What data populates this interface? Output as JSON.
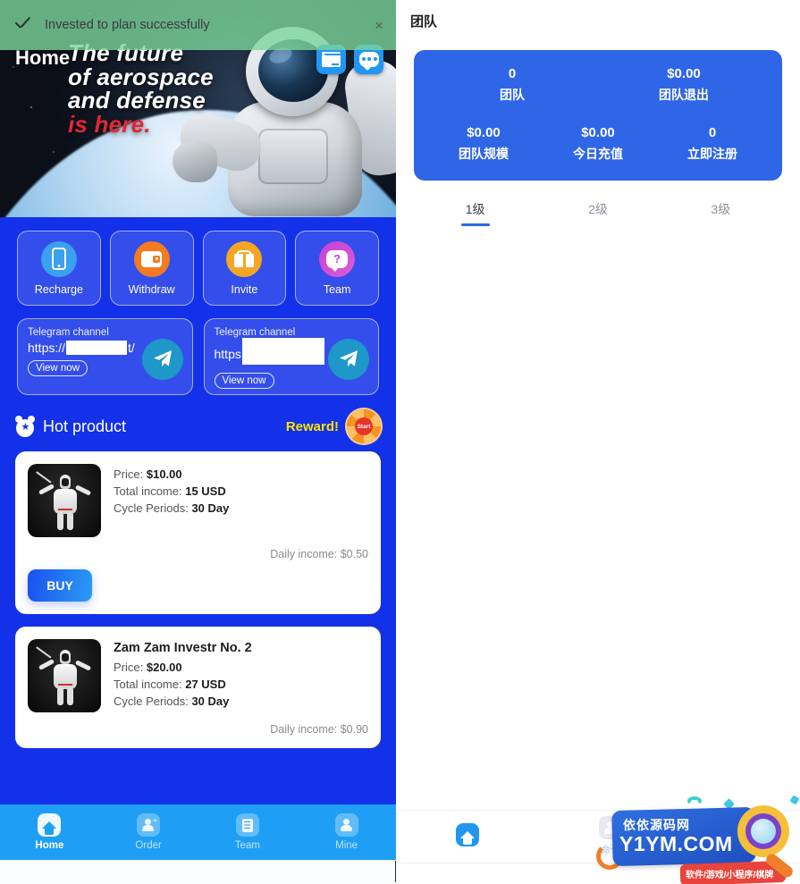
{
  "toast": {
    "message": "Invested to plan successfully",
    "check_icon": "check-icon",
    "close_icon": "×"
  },
  "left": {
    "home_label": "Home",
    "banner": {
      "line1": "The future",
      "line2": "of aerospace",
      "line3": "and defense",
      "line4": "is here."
    },
    "banner_icons": [
      {
        "name": "mail-icon"
      },
      {
        "name": "chat-icon"
      }
    ],
    "actions": [
      {
        "label": "Recharge",
        "icon": "phone-icon",
        "color": "#3aa0f0"
      },
      {
        "label": "Withdraw",
        "icon": "wallet-icon",
        "color": "#f47b20"
      },
      {
        "label": "Invite",
        "icon": "gift-icon",
        "color": "#f5a623"
      },
      {
        "label": "Team",
        "icon": "question-bubble-icon",
        "color": "#c042d8"
      }
    ],
    "telegram": [
      {
        "title": "Telegram channel",
        "url_prefix": "https://",
        "url_suffix": "t/",
        "button": "View now"
      },
      {
        "title": "Telegram channel",
        "url_prefix": "https",
        "url_suffix": "",
        "button": "View now"
      }
    ],
    "hot": {
      "title": "Hot product",
      "icon": "medal-star-icon",
      "reward_label": "Reward!",
      "wheel_label": "Start"
    },
    "products": [
      {
        "name": "",
        "price_label": "Price:",
        "price": "$10.00",
        "income_label": "Total income:",
        "income": "15 USD",
        "cycle_label": "Cycle Periods:",
        "cycle": "30 Day",
        "daily": "Daily income: $0.50",
        "buy": "BUY"
      },
      {
        "name": "Zam Zam Investr No. 2",
        "price_label": "Price:",
        "price": "$20.00",
        "income_label": "Total income:",
        "income": "27 USD",
        "cycle_label": "Cycle Periods:",
        "cycle": "30 Day",
        "daily": "Daily income: $0.90",
        "buy": ""
      }
    ],
    "nav": [
      {
        "label": "Home",
        "icon": "home-icon",
        "active": true
      },
      {
        "label": "Order",
        "icon": "user-plus-icon",
        "active": false
      },
      {
        "label": "Team",
        "icon": "document-icon",
        "active": false
      },
      {
        "label": "Mine",
        "icon": "user-icon",
        "active": false
      }
    ]
  },
  "right": {
    "title": "团队",
    "stats_top": [
      {
        "value": "0",
        "label": "团队"
      },
      {
        "value": "$0.00",
        "label": "团队退出"
      }
    ],
    "stats_bottom": [
      {
        "value": "$0.00",
        "label": "团队规模"
      },
      {
        "value": "$0.00",
        "label": "今日充值"
      },
      {
        "value": "0",
        "label": "立即注册"
      }
    ],
    "level_tabs": [
      {
        "label": "1级",
        "active": true
      },
      {
        "label": "2级",
        "active": false
      },
      {
        "label": "3级",
        "active": false
      }
    ],
    "nav": [
      {
        "label": "",
        "icon": "home-icon",
        "active": true
      },
      {
        "label": "命令",
        "icon": "user-plus-icon",
        "active": false
      }
    ],
    "card_color": "#2f66e8"
  },
  "watermark": {
    "cn": "依依源码网",
    "en": "Y1YM.COM",
    "tag": "软件/游戏/小程序/棋牌"
  }
}
